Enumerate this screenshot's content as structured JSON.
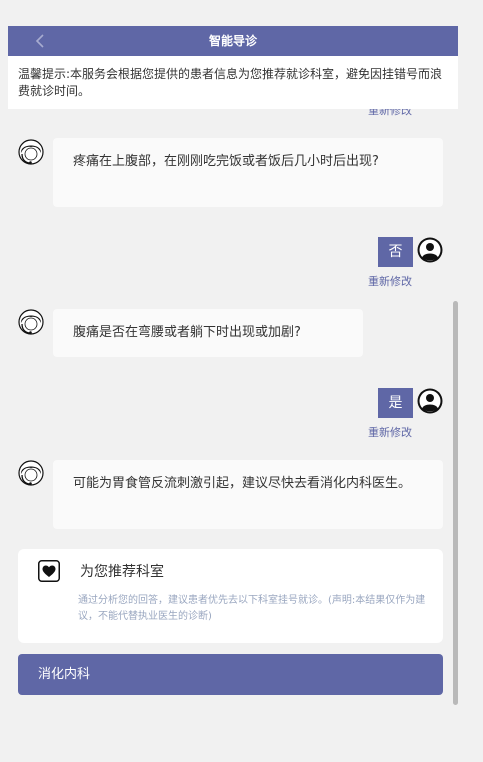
{
  "header": {
    "title": "智能导诊"
  },
  "notice": {
    "text": "温馨提示:本服务会根据您提供的患者信息为您推荐就诊科室，避免因挂错号而浪费就诊时间。"
  },
  "modify_label": "重新修改",
  "chat": {
    "q1": "疼痛在上腹部，在刚刚吃完饭或者饭后几小时后出现?",
    "a1": "否",
    "q2": "腹痛是否在弯腰或者躺下时出现或加剧?",
    "a2": "是",
    "result": "可能为胃食管反流刺激引起，建议尽快去看消化内科医生。"
  },
  "recommend": {
    "title": "为您推荐科室",
    "desc": "通过分析您的回答，建议患者优先去以下科室挂号就诊。(声明:本结果仅作为建议，不能代替执业医生的诊断)",
    "department": "消化内科"
  },
  "colors": {
    "accent": "#5f67a6",
    "background": "#f1f1f1"
  },
  "icons": {
    "back": "chevron-left-icon",
    "bot": "doctor-avatar-icon",
    "user": "user-avatar-icon",
    "recommend": "heart-icon"
  }
}
